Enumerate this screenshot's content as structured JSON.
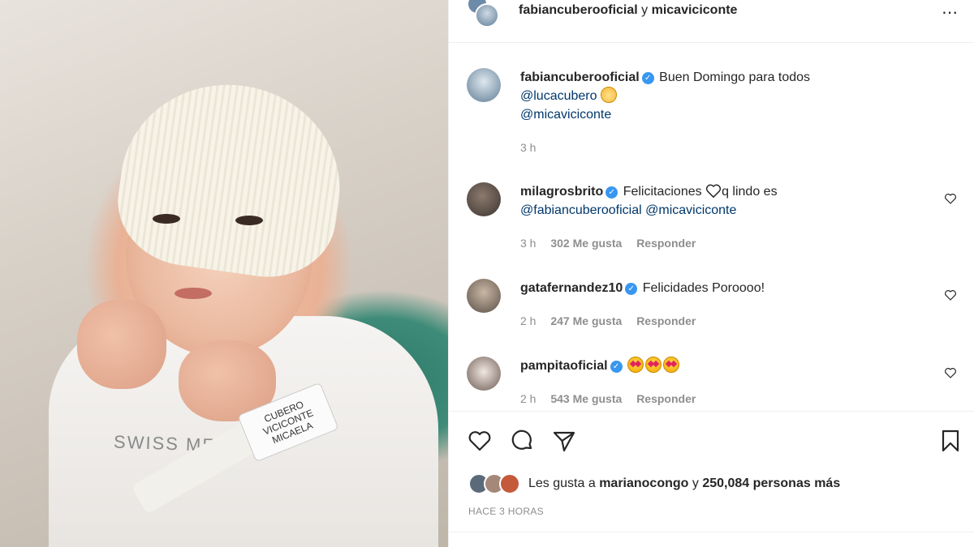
{
  "header": {
    "user1": "fabiancuberooficial",
    "joiner": "y",
    "user2": "micaviciconte",
    "more_icon": "⋯"
  },
  "photo": {
    "shirt_text": "SWISS MED",
    "band_line1": "CUBERO",
    "band_line2": "VICICONTE",
    "band_line3": "MICAELA"
  },
  "caption": {
    "user": "fabiancuberooficial",
    "text": "Buen Domingo para todos",
    "mention1": "@lucacubero",
    "mention2": "@micaviciconte",
    "time": "3 h"
  },
  "comments": [
    {
      "user": "milagrosbrito",
      "text_before": "Felicitaciones",
      "text_after": "q lindo es",
      "mention1": "@fabiancuberooficial",
      "mention2": "@micaviciconte",
      "time": "3 h",
      "likes": "302 Me gusta",
      "reply": "Responder"
    },
    {
      "user": "gatafernandez10",
      "text": "Felicidades Poroooo!",
      "time": "2 h",
      "likes": "247 Me gusta",
      "reply": "Responder"
    },
    {
      "user": "pampitaoficial",
      "time": "2 h",
      "likes": "543 Me gusta",
      "reply": "Responder"
    }
  ],
  "likes": {
    "prefix": "Les gusta a",
    "user": "marianocongo",
    "joiner": "y",
    "count": "250,084 personas más"
  },
  "timestamp": "HACE 3 HORAS",
  "colors": {
    "verified": "#3897f0",
    "mention": "#00376b",
    "muted": "#8e8e8e"
  }
}
